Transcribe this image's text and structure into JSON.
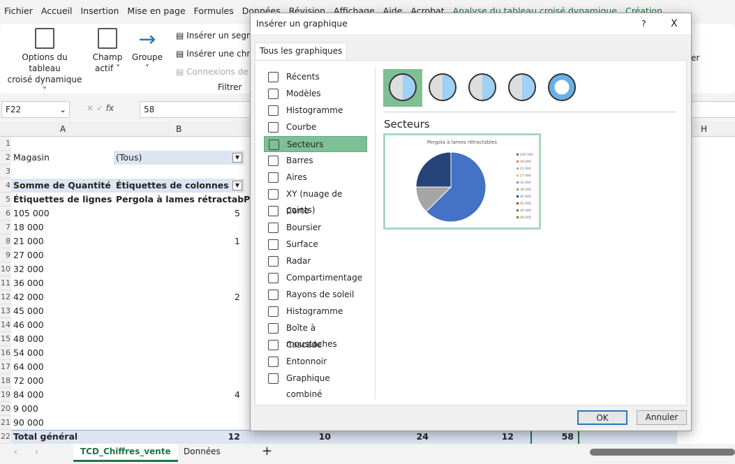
{
  "menu": [
    "Fichier",
    "Accueil",
    "Insertion",
    "Mise en page",
    "Formules",
    "Données",
    "Révision",
    "Affichage",
    "Aide",
    "Acrobat",
    "Analyse du tableau croisé dynamique",
    "Création"
  ],
  "ribbon": {
    "options_l1": "Options du tableau",
    "options_l2": "croisé dynamique ˅",
    "champ_l1": "Champ",
    "champ_l2": "actif ˅",
    "groupe": "Groupe",
    "groupe_arrow": "˅",
    "segment": "Insérer un segment",
    "chrono": "Insérer une chronologie",
    "connexions": "Connexions de filtre",
    "filtrer": "Filtrer",
    "right_fragment": "er"
  },
  "formula": {
    "namebox": "F22",
    "fx": "fx",
    "value": "58"
  },
  "columns": [
    "A",
    "B",
    "H"
  ],
  "rows": [
    "1",
    "2",
    "3",
    "4",
    "5",
    "6",
    "7",
    "8",
    "9",
    "10",
    "11",
    "12",
    "13",
    "14",
    "15",
    "16",
    "17",
    "18",
    "19",
    "20",
    "21",
    "22"
  ],
  "pivot": {
    "magasin": "Magasin",
    "tous": "(Tous)",
    "somme": "Somme de Quantité",
    "etiq_col": "Étiquettes de colonnes",
    "etiq_lig": "Étiquettes de lignes",
    "pergola": "Pergola à lames rétractables",
    "p_frag": "P",
    "labels": [
      "105 000",
      "18 000",
      "21 000",
      "27 000",
      "32 000",
      "36 000",
      "42 000",
      "45 000",
      "46 000",
      "48 000",
      "54 000",
      "64 000",
      "72 000",
      "84 000",
      "9 000",
      "90 000"
    ],
    "pergola_vals": [
      "5",
      "",
      "1",
      "",
      "",
      "",
      "2",
      "",
      "",
      "",
      "",
      "",
      "",
      "4",
      "",
      ""
    ],
    "total_label": "Total général",
    "totals": [
      "12",
      "10",
      "24",
      "12",
      "58"
    ]
  },
  "sheets": {
    "active": "TCD_Chiffres_vente",
    "other": "Données",
    "add": "+"
  },
  "dialog": {
    "title": "Insérer un graphique",
    "help": "?",
    "close": "X",
    "tab": "Tous les graphiques",
    "types": [
      "Récents",
      "Modèles",
      "Histogramme",
      "Courbe",
      "Secteurs",
      "Barres",
      "Aires",
      "XY (nuage de points)",
      "Carte",
      "Boursier",
      "Surface",
      "Radar",
      "Compartimentage",
      "Rayons de soleil",
      "Histogramme",
      "Boîte à moustaches",
      "Cascade",
      "Entonnoir",
      "Graphique combiné"
    ],
    "selected_type": "Secteurs",
    "subtypes": [
      "pie-2d",
      "pie-3d",
      "pie-of-pie",
      "bar-of-pie",
      "doughnut"
    ],
    "heading": "Secteurs",
    "ok": "OK",
    "cancel": "Annuler"
  },
  "chart_data": {
    "type": "pie",
    "title": "Pergola à lames rétractables",
    "categories": [
      "105 000",
      "18 000",
      "21 000",
      "27 000",
      "32 000",
      "36 000",
      "42 000",
      "45 000",
      "46 000",
      "48 000"
    ],
    "values": [
      5,
      0,
      1,
      0,
      0,
      0,
      2,
      0,
      0,
      0
    ],
    "colors": [
      "#4472c4",
      "#ed7d31",
      "#a5a5a5",
      "#ffc000",
      "#5b9bd5",
      "#70ad47",
      "#264478",
      "#9e480e",
      "#636363",
      "#997300"
    ],
    "legend": "right"
  },
  "colors": {
    "accent": "#217346",
    "selected": "#7fbf94",
    "pivot_header": "#dde4f2"
  }
}
